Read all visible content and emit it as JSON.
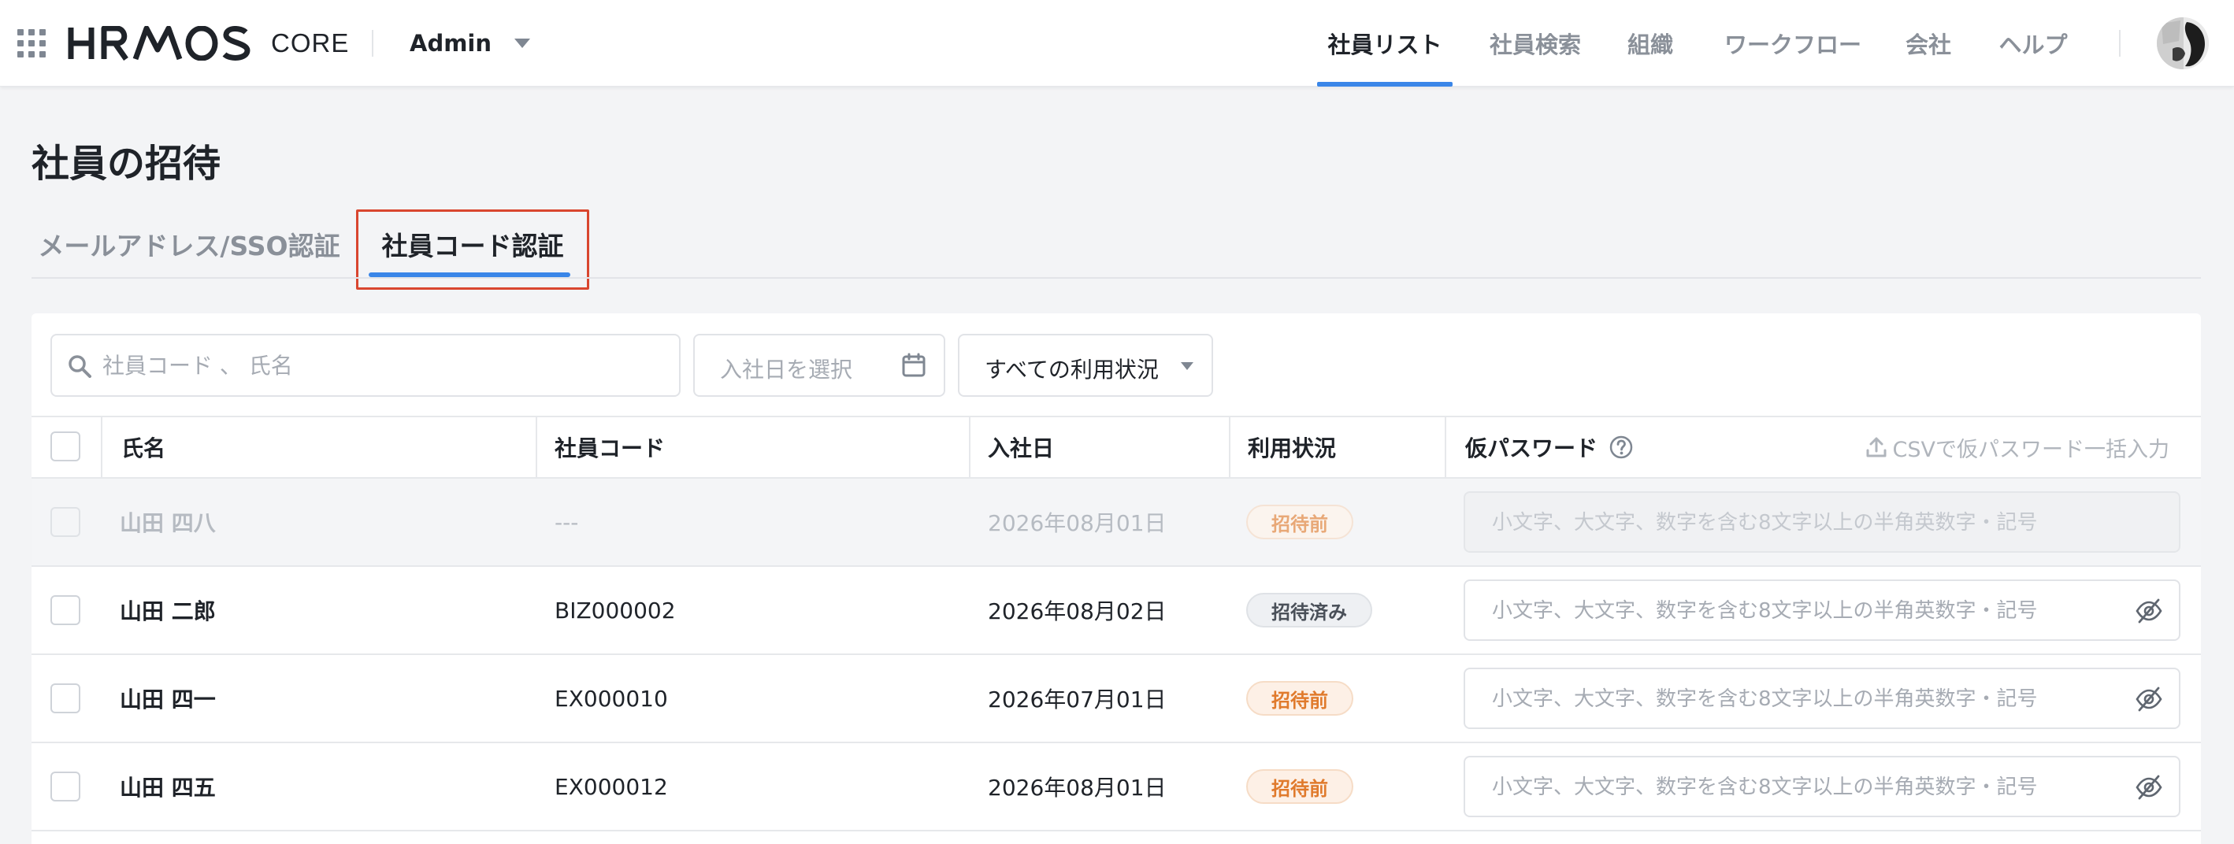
{
  "header": {
    "brand": "HRMOS",
    "brand_sub": "CORE",
    "account": "Admin",
    "nav": [
      {
        "label": "社員リスト",
        "active": true
      },
      {
        "label": "社員検索",
        "active": false
      },
      {
        "label": "組織",
        "active": false
      },
      {
        "label": "ワークフロー",
        "active": false
      },
      {
        "label": "会社",
        "active": false
      },
      {
        "label": "ヘルプ",
        "active": false
      }
    ]
  },
  "page": {
    "title": "社員の招待",
    "tabs": [
      {
        "label": "メールアドレス/SSO認証",
        "active": false
      },
      {
        "label": "社員コード認証",
        "active": true
      }
    ]
  },
  "filters": {
    "search_placeholder": "社員コード 、 氏名",
    "date_placeholder": "入社日を選択",
    "status_value": "すべての利用状況"
  },
  "table": {
    "headers": {
      "name": "氏名",
      "code": "社員コード",
      "joined": "入社日",
      "status": "利用状況",
      "password": "仮パスワード",
      "csv": "CSVで仮パスワード一括入力"
    },
    "password_placeholder": "小文字、大文字、数字を含む8文字以上の半角英数字・記号",
    "rows": [
      {
        "name": "山田 四八",
        "code": "---",
        "joined": "2026年08月01日",
        "status": "招待前",
        "status_type": "pre",
        "disabled": true
      },
      {
        "name": "山田 二郎",
        "code": "BIZ000002",
        "joined": "2026年08月02日",
        "status": "招待済み",
        "status_type": "done",
        "disabled": false
      },
      {
        "name": "山田 四一",
        "code": "EX000010",
        "joined": "2026年07月01日",
        "status": "招待前",
        "status_type": "pre",
        "disabled": false
      },
      {
        "name": "山田 四五",
        "code": "EX000012",
        "joined": "2026年08月01日",
        "status": "招待前",
        "status_type": "pre",
        "disabled": false
      }
    ]
  },
  "colors": {
    "accent": "#3a86e8",
    "highlight": "#d9462f",
    "badge_pre": "#e07a2c"
  },
  "icons": {
    "apps": "apps-grid-icon",
    "caret": "caret-down-icon",
    "search": "search-icon",
    "calendar": "calendar-icon",
    "help": "help-circle-icon",
    "upload": "upload-icon",
    "eye": "eye-off-icon"
  }
}
